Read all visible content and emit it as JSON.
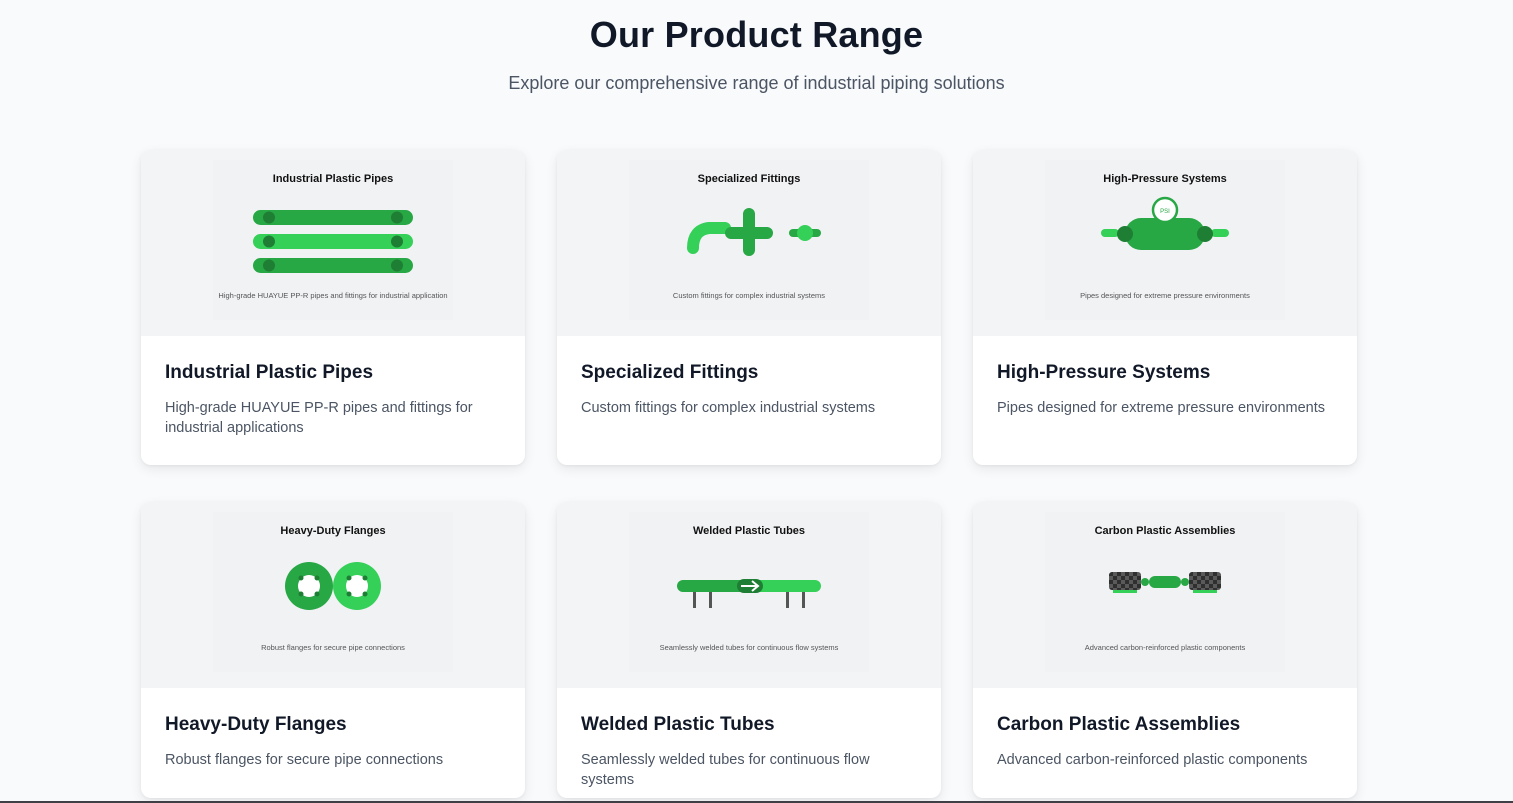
{
  "header": {
    "title": "Our Product Range",
    "subtitle": "Explore our comprehensive range of industrial piping solutions"
  },
  "colors": {
    "green_dark": "#28a745",
    "green_light": "#34d058",
    "green_deep": "#1e7e34",
    "carbon": "#3a3a3a"
  },
  "products": [
    {
      "title": "Industrial Plastic Pipes",
      "description": "High-grade HUAYUE PP-R pipes and fittings for industrial applications",
      "image_title": "Industrial Plastic Pipes",
      "image_caption": "High-grade HUAYUE PP-R pipes and fittings for industrial application",
      "icon": "pipes-icon"
    },
    {
      "title": "Specialized Fittings",
      "description": "Custom fittings for complex industrial systems",
      "image_title": "Specialized Fittings",
      "image_caption": "Custom fittings for complex industrial systems",
      "icon": "fittings-icon"
    },
    {
      "title": "High-Pressure Systems",
      "description": "Pipes designed for extreme pressure environments",
      "image_title": "High-Pressure Systems",
      "image_caption": "Pipes designed for extreme pressure environments",
      "gauge_label": "PSI",
      "icon": "pressure-gauge-icon"
    },
    {
      "title": "Heavy-Duty Flanges",
      "description": "Robust flanges for secure pipe connections",
      "image_title": "Heavy-Duty Flanges",
      "image_caption": "Robust flanges for secure pipe connections",
      "icon": "flanges-icon"
    },
    {
      "title": "Welded Plastic Tubes",
      "description": "Seamlessly welded tubes for continuous flow systems",
      "image_title": "Welded Plastic Tubes",
      "image_caption": "Seamlessly welded tubes for continuous flow systems",
      "icon": "welded-tube-icon"
    },
    {
      "title": "Carbon Plastic Assemblies",
      "description": "Advanced carbon-reinforced plastic components",
      "image_title": "Carbon Plastic Assemblies",
      "image_caption": "Advanced carbon-reinforced plastic components",
      "icon": "carbon-assembly-icon"
    }
  ]
}
